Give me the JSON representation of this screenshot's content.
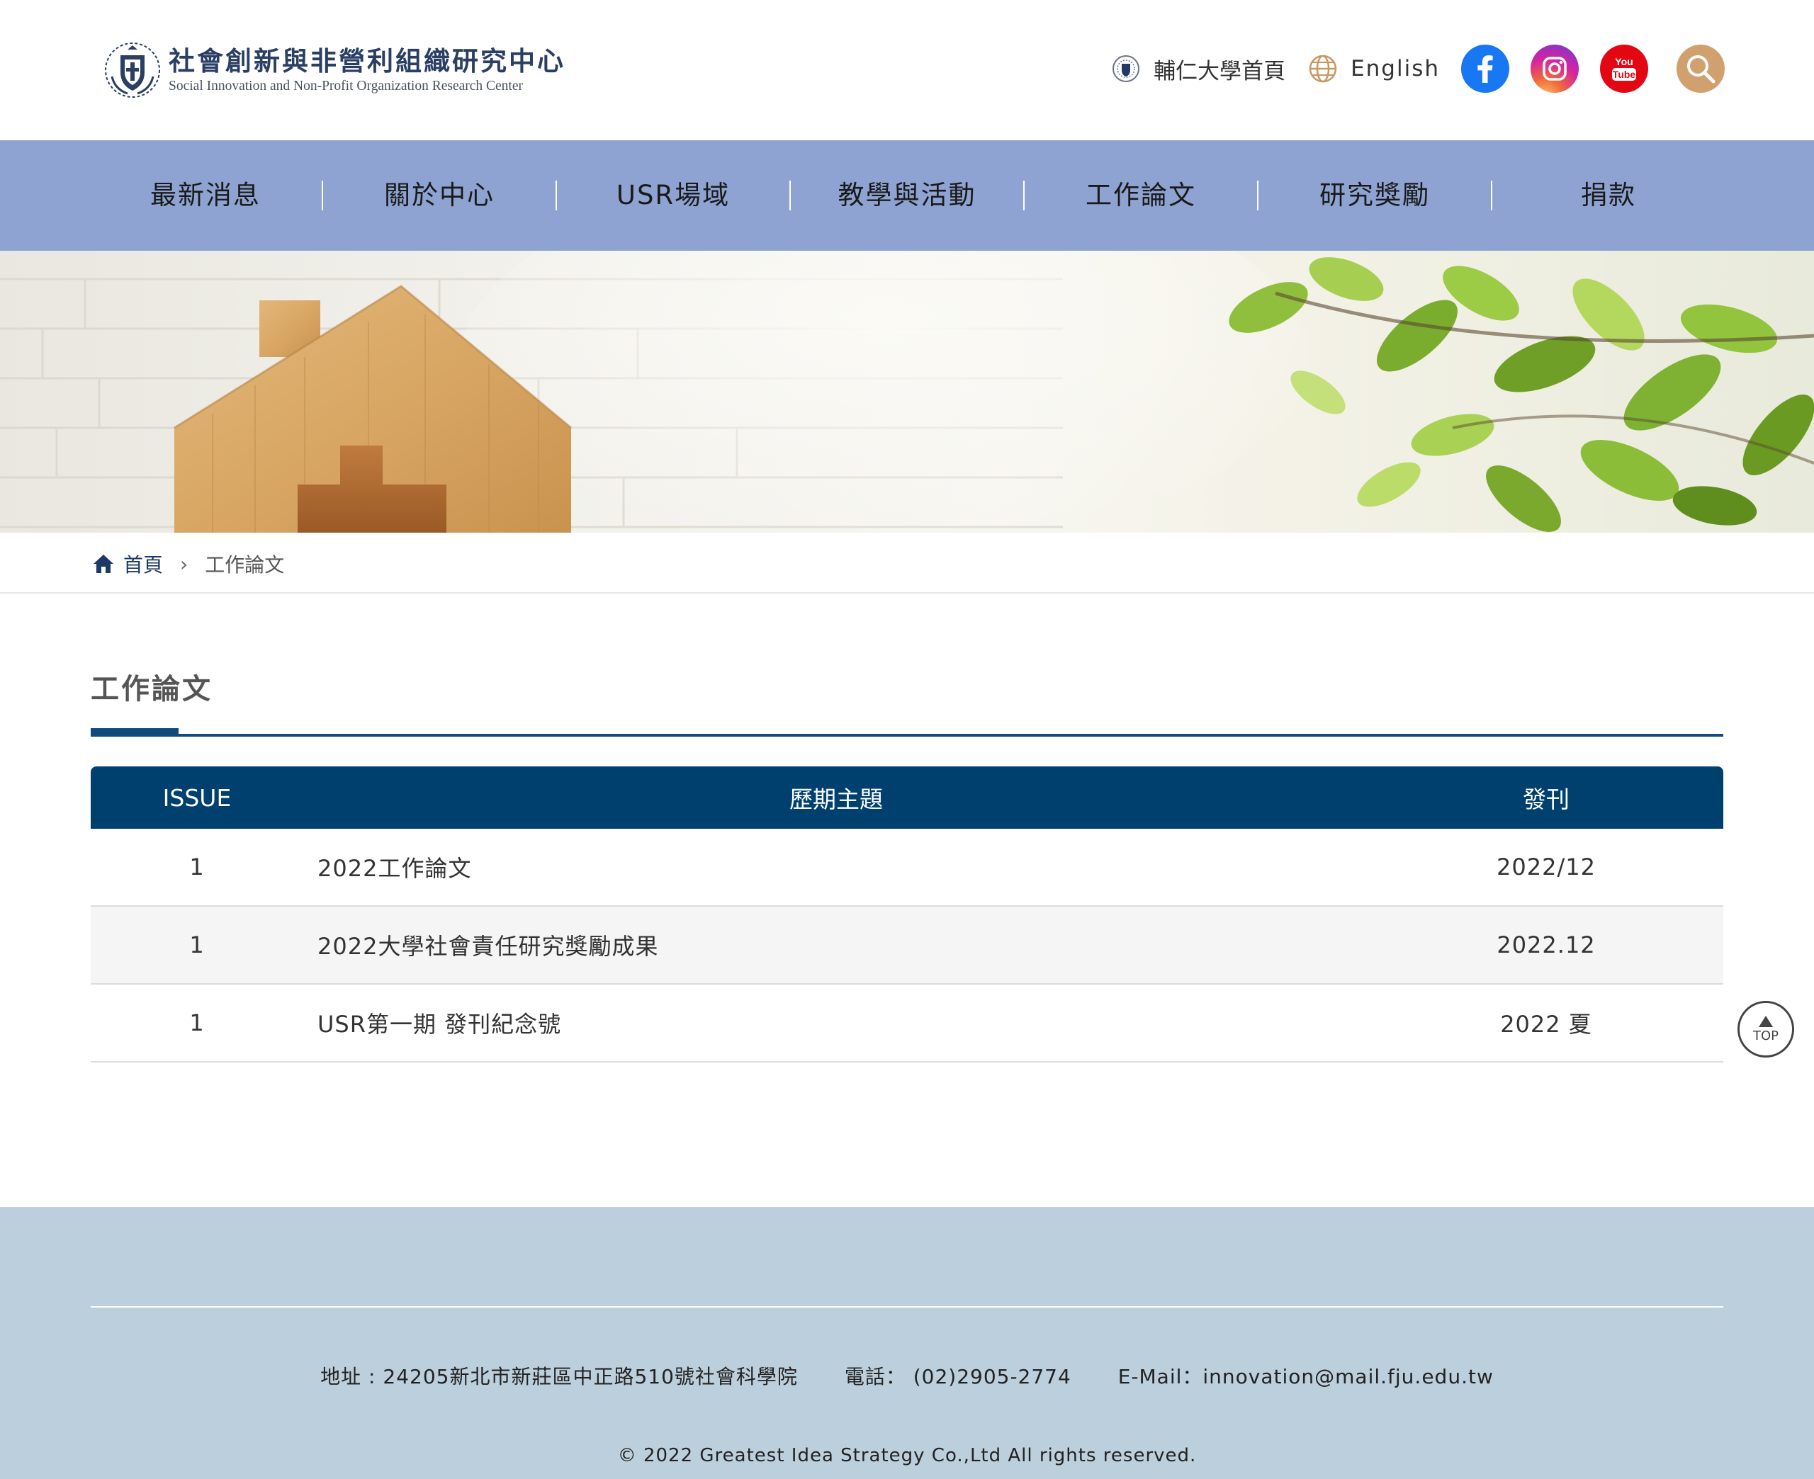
{
  "header": {
    "logo_title": "社會創新與非營利組織研究中心",
    "logo_subtitle": "Social Innovation and Non-Profit Organization Research Center",
    "fju_home": "輔仁大學首頁",
    "english": "English",
    "youtube_text_1": "You",
    "youtube_text_2": "Tube"
  },
  "nav": {
    "items": [
      {
        "label": "最新消息"
      },
      {
        "label": "關於中心"
      },
      {
        "label": "USR場域"
      },
      {
        "label": "教學與活動"
      },
      {
        "label": "工作論文"
      },
      {
        "label": "研究獎勵"
      },
      {
        "label": "捐款"
      }
    ]
  },
  "breadcrumb": {
    "home": "首頁",
    "current": "工作論文"
  },
  "page": {
    "title": "工作論文"
  },
  "table": {
    "headers": {
      "issue": "ISSUE",
      "topic": "歷期主題",
      "date": "發刊"
    },
    "rows": [
      {
        "issue": "1",
        "topic": "2022工作論文",
        "date": "2022/12"
      },
      {
        "issue": "1",
        "topic": "2022大學社會責任研究獎勵成果",
        "date": "2022.12"
      },
      {
        "issue": "1",
        "topic": "USR第一期 發刊紀念號",
        "date": "2022 夏"
      }
    ]
  },
  "top_button": {
    "label": "TOP"
  },
  "footer": {
    "address": "地址 : 24205新北市新莊區中正路510號社會科學院",
    "phone": "電話： (02)2905-2774",
    "email": "E-Mail：innovation@mail.fju.edu.tw",
    "copyright": "© 2022 Greatest Idea Strategy Co.,Ltd All rights reserved."
  },
  "colors": {
    "nav_bg": "#8ea3d1",
    "table_header": "#00406e",
    "accent_rule": "#0f4c7d",
    "footer_bg": "#bccfdc",
    "search_btn": "#d1a06f"
  },
  "icons": {
    "logo": "university-emblem-icon",
    "fju": "fju-seal-icon",
    "english": "globe-icon",
    "facebook": "facebook-icon",
    "instagram": "instagram-icon",
    "youtube": "youtube-icon",
    "search": "search-icon",
    "home": "home-icon",
    "breadcrumb_sep": "chevron-right-icon",
    "top": "arrow-up-icon"
  }
}
